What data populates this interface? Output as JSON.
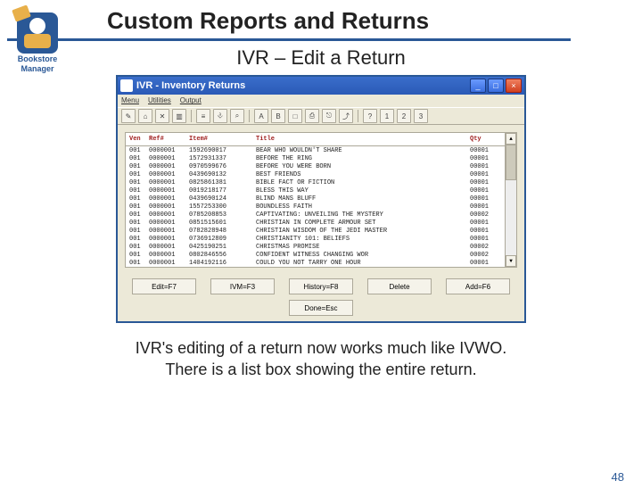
{
  "page": {
    "title": "Custom Reports and Returns",
    "subtitle": "IVR – Edit a Return",
    "caption_line1": "IVR's editing of a return now works much like IVWO.",
    "caption_line2": "There is a list box showing the entire return.",
    "number": "48",
    "logo_line1": "Bookstore",
    "logo_line2": "Manager"
  },
  "win": {
    "title": "IVR - Inventory Returns",
    "min": "_",
    "max": "□",
    "close": "×",
    "menu": [
      "Menu",
      "Utilities",
      "Output"
    ],
    "tools": [
      "✎",
      "⌂",
      "✕",
      "▥",
      "≡",
      "⎀",
      "⌕",
      "A",
      "B",
      "□",
      "⎙",
      "⎋",
      "⤴",
      "?",
      "1",
      "2",
      "3"
    ],
    "cols": {
      "ven": "Ven",
      "ref": "Ref#",
      "item": "Item#",
      "title": "Title",
      "qty": "Qty"
    },
    "rows": [
      {
        "ven": "001",
        "ref": "0000001",
        "item": "1592690017",
        "title": "BEAR WHO WOULDN'T SHARE",
        "qty": "00001"
      },
      {
        "ven": "001",
        "ref": "0000001",
        "item": "1572931337",
        "title": "BEFORE THE RING",
        "qty": "00001"
      },
      {
        "ven": "001",
        "ref": "0000001",
        "item": "0970599676",
        "title": "BEFORE YOU WERE BORN",
        "qty": "00001"
      },
      {
        "ven": "001",
        "ref": "0000001",
        "item": "0439690132",
        "title": "BEST FRIENDS",
        "qty": "00001"
      },
      {
        "ven": "001",
        "ref": "0000001",
        "item": "0825861381",
        "title": "BIBLE FACT OR FICTION",
        "qty": "00001"
      },
      {
        "ven": "001",
        "ref": "0000001",
        "item": "0019218177",
        "title": "BLESS THIS WAY",
        "qty": "00001"
      },
      {
        "ven": "001",
        "ref": "0000001",
        "item": "0439690124",
        "title": "BLIND MANS BLUFF",
        "qty": "00001"
      },
      {
        "ven": "001",
        "ref": "0000001",
        "item": "1557253300",
        "title": "BOUNDLESS FAITH",
        "qty": "00001"
      },
      {
        "ven": "001",
        "ref": "0000001",
        "item": "0785208853",
        "title": "CAPTIVATING: UNVEILING THE MYSTERY",
        "qty": "00002"
      },
      {
        "ven": "001",
        "ref": "0000001",
        "item": "0851515601",
        "title": "CHRISTIAN IN COMPLETE ARMOUR SET",
        "qty": "00001"
      },
      {
        "ven": "001",
        "ref": "0000001",
        "item": "0782828948",
        "title": "CHRISTIAN WISDOM OF THE JEDI MASTER",
        "qty": "00001"
      },
      {
        "ven": "001",
        "ref": "0000001",
        "item": "0736912809",
        "title": "CHRISTIANITY 101: BELIEFS",
        "qty": "00001"
      },
      {
        "ven": "001",
        "ref": "0000001",
        "item": "0425190251",
        "title": "CHRISTMAS PROMISE",
        "qty": "00002"
      },
      {
        "ven": "001",
        "ref": "0000001",
        "item": "0802846556",
        "title": "CONFIDENT WITNESS CHANGING WOR",
        "qty": "00002"
      },
      {
        "ven": "001",
        "ref": "0000001",
        "item": "1404192116",
        "title": "COULD YOU NOT TARRY ONE HOUR",
        "qty": "00001"
      }
    ],
    "scroll": {
      "up": "▲",
      "down": "▼"
    },
    "buttons": {
      "edit": "Edit=F7",
      "ivm": "IVM=F3",
      "history": "History=F8",
      "delete": "Delete",
      "add": "Add=F6",
      "done": "Done=Esc"
    }
  }
}
